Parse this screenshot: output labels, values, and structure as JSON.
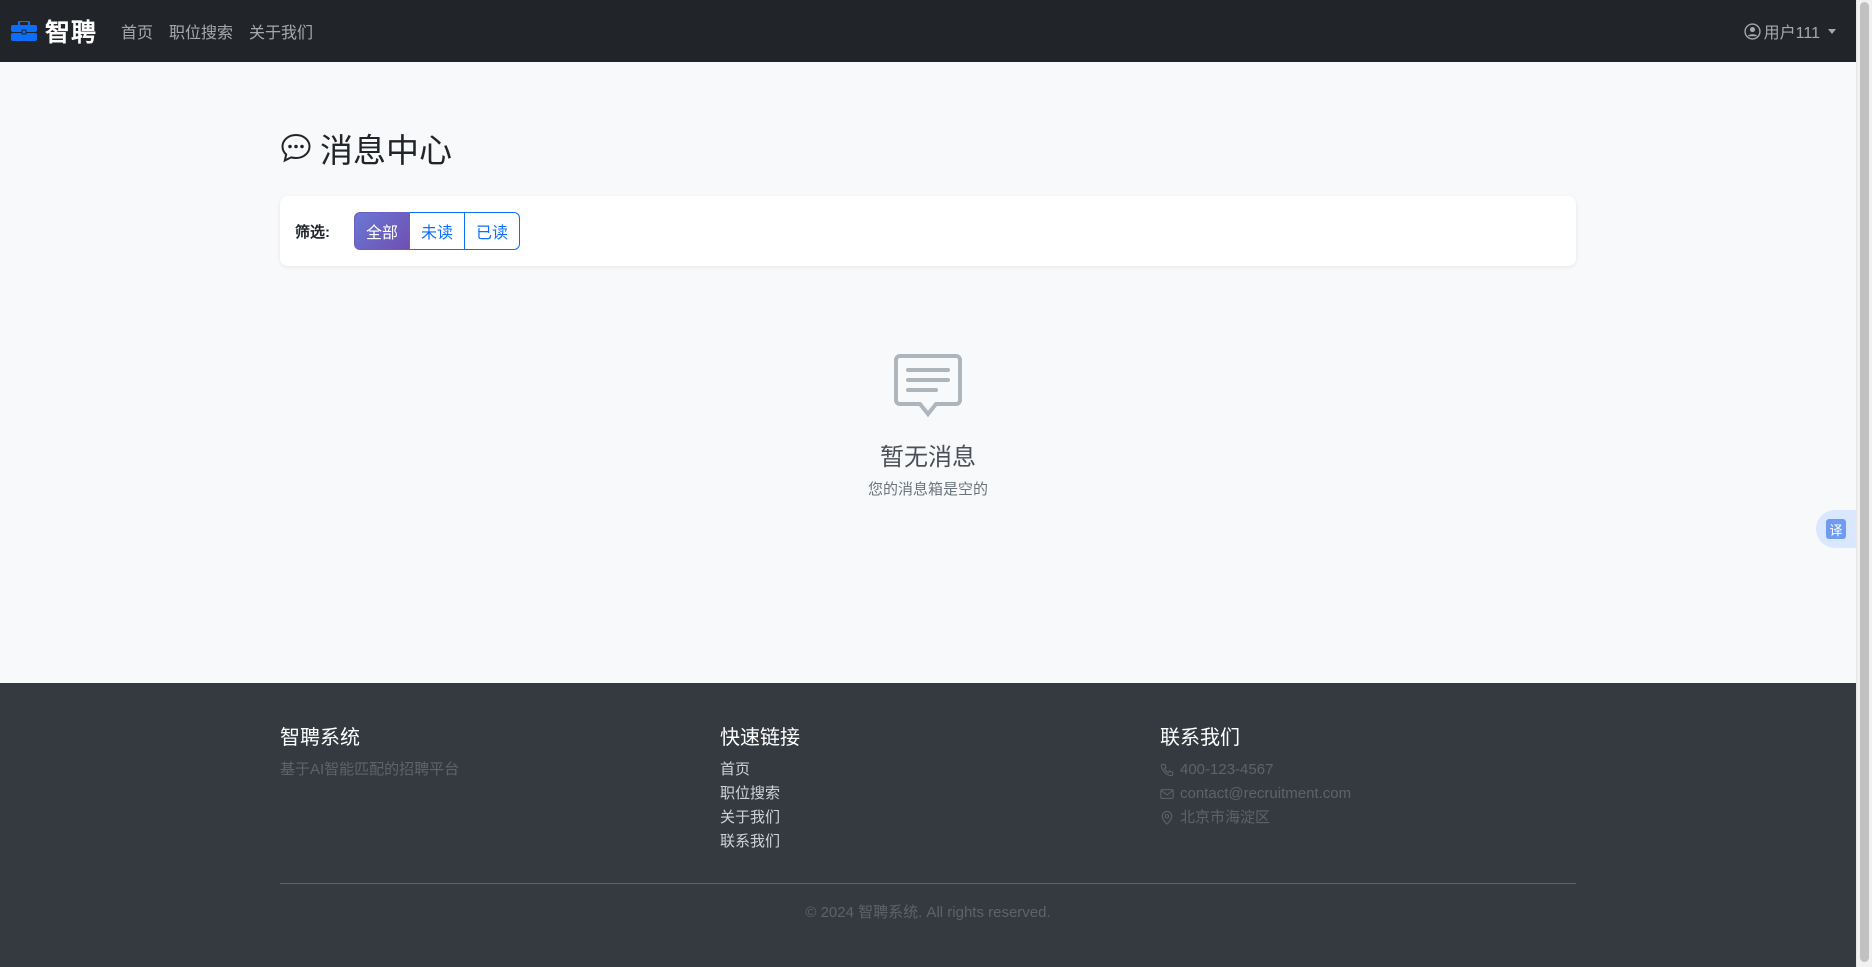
{
  "navbar": {
    "brand": "智聘",
    "links": [
      "首页",
      "职位搜索",
      "关于我们"
    ],
    "user": "用户111",
    "brand_color": "#0d6efd"
  },
  "page": {
    "title": "消息中心",
    "filter_label": "筛选:",
    "filters": [
      "全部",
      "未读",
      "已读"
    ],
    "active_filter": "全部"
  },
  "empty": {
    "title": "暂无消息",
    "subtitle": "您的消息箱是空的"
  },
  "translate": {
    "label": "译"
  },
  "footer": {
    "about": {
      "title": "智聘系统",
      "desc": "基于AI智能匹配的招聘平台"
    },
    "links": {
      "title": "快速链接",
      "items": [
        "首页",
        "职位搜索",
        "关于我们",
        "联系我们"
      ]
    },
    "contact": {
      "title": "联系我们",
      "phone": "400-123-4567",
      "email": "contact@recruitment.com",
      "address": "北京市海淀区"
    },
    "copyright": "© 2024 智聘系统. All rights reserved."
  }
}
